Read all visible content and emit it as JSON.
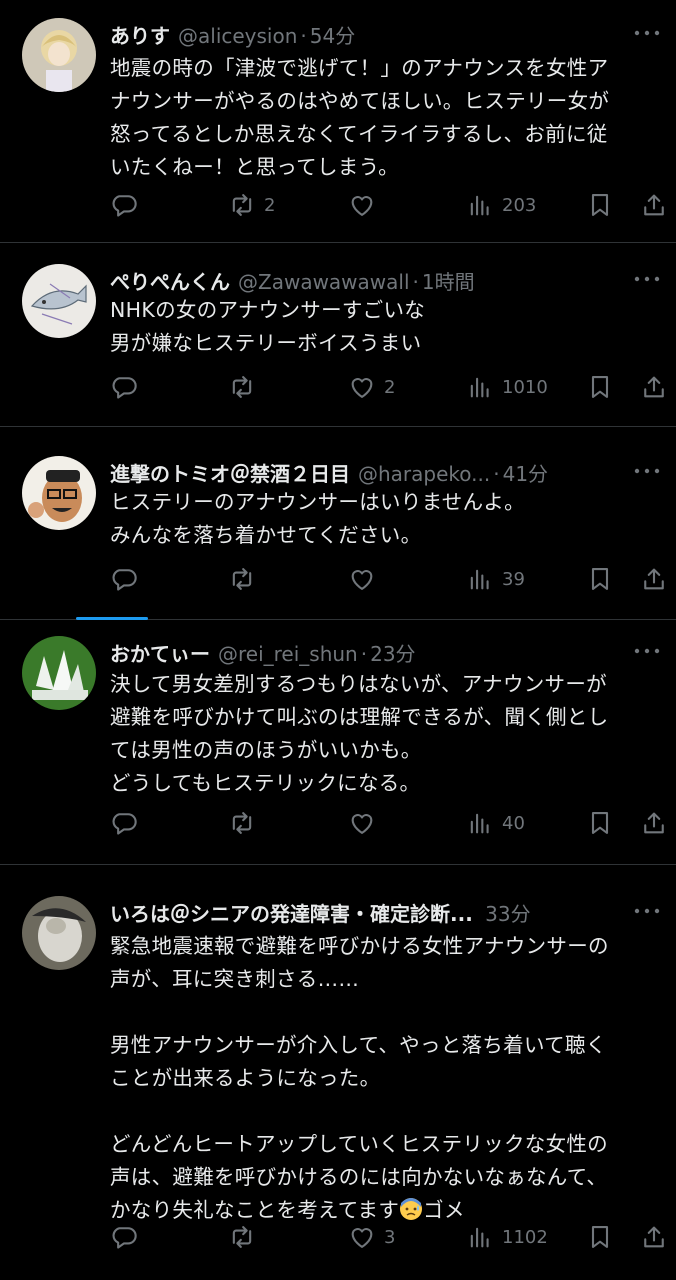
{
  "tweets": [
    {
      "name": "ありす",
      "handle": "@aliceysion",
      "time": "54分",
      "lines": [
        "地震の時の「津波で逃げて！」のアナウンスを女性ア",
        "ナウンサーがやるのはやめてほしい。ヒステリー女が",
        "怒ってるとしか思えなくてイライラするし、お前に従",
        "いたくねー！と思ってしまう。"
      ],
      "retweets": "2",
      "likes": "",
      "views": "203"
    },
    {
      "name": "ぺりぺんくん",
      "handle": "@Zawawawawall",
      "time": "1時間",
      "lines": [
        "NHKの女のアナウンサーすごいな",
        "男が嫌なヒステリーボイスうまい"
      ],
      "retweets": "",
      "likes": "2",
      "views": "1010"
    },
    {
      "name": "進撃のトミオ＠禁酒２日目",
      "handle": "@harapeko...",
      "time": "41分",
      "lines": [
        "ヒステリーのアナウンサーはいりませんよ。",
        "みんなを落ち着かせてください。"
      ],
      "retweets": "",
      "likes": "",
      "views": "39"
    },
    {
      "name": "おかてぃー",
      "handle": "@rei_rei_shun",
      "time": "23分",
      "lines": [
        "決して男女差別するつもりはないが、アナウンサーが",
        "避難を呼びかけて叫ぶのは理解できるが、聞く側とし",
        "ては男性の声のほうがいいかも。",
        "どうしてもヒステリックになる。"
      ],
      "retweets": "",
      "likes": "",
      "views": "40"
    },
    {
      "name": "いろは＠シニアの発達障害・確定診断...",
      "handle": "",
      "time": "33分",
      "lines": [
        "緊急地震速報で避難を呼びかける女性アナウンサーの",
        "声が、耳に突き刺さる……",
        "",
        "男性アナウンサーが介入して、やっと落ち着いて聴く",
        "ことが出来るようになった。",
        "",
        "どんどんヒートアップしていくヒステリックな女性の",
        "声は、避難を呼びかけるのには向かないなぁなんて、"
      ],
      "last_line_before_emoji": "かなり失礼なことを考えてます",
      "last_line_after_emoji": "ゴメ",
      "retweets": "",
      "likes": "3",
      "views": "1102"
    }
  ]
}
